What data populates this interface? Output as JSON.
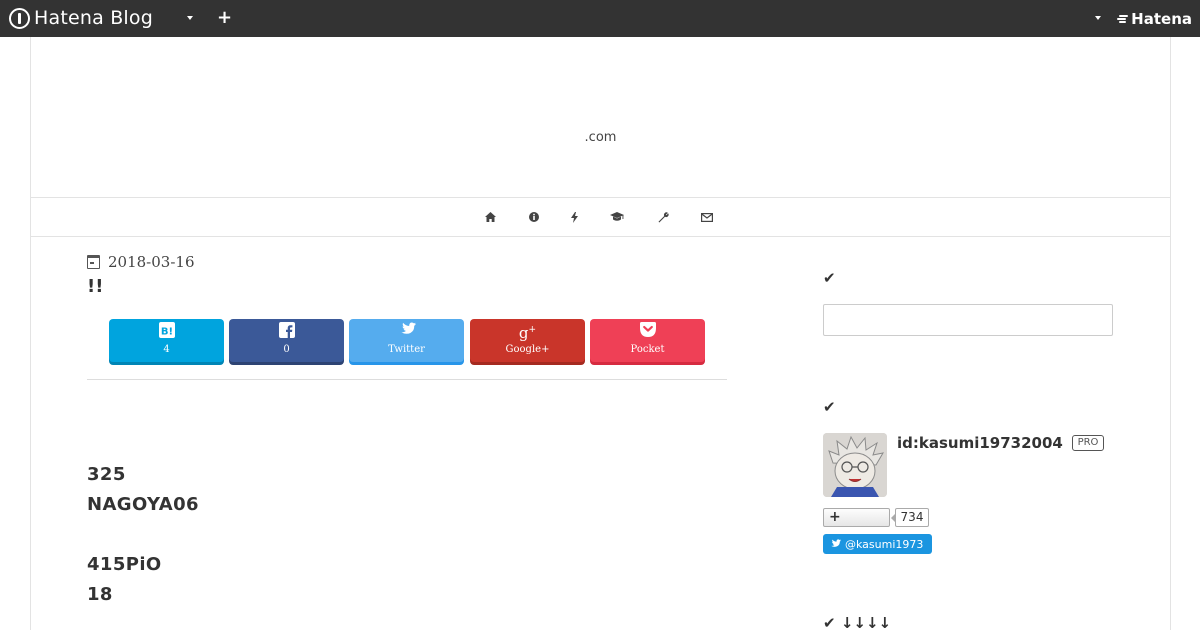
{
  "topbar": {
    "logo_text": "Hatena Blog",
    "right_brand": "Hatena"
  },
  "blog": {
    "title": ".com"
  },
  "nav": {
    "icons": [
      "home-icon",
      "info-icon",
      "bolt-icon",
      "graduation-cap-icon",
      "wrench-icon",
      "envelope-icon"
    ]
  },
  "entry": {
    "date": "2018-03-16",
    "title": "!!",
    "share": [
      {
        "label": "4",
        "icon": "B!",
        "color": "#00a4de"
      },
      {
        "label": "0",
        "icon": "f",
        "color": "#3b5998"
      },
      {
        "label": "Twitter",
        "icon": "twitter-bird",
        "color": "#55acee"
      },
      {
        "label": "Google+",
        "icon": "g+",
        "color": "#dc4e41"
      },
      {
        "label": "Pocket",
        "icon": "pocket",
        "color": "#ef4056"
      }
    ],
    "body_lines": [
      "325",
      "NAGOYA06",
      "415PiO",
      "18"
    ]
  },
  "sidebar": {
    "profile_id": "id:kasumi19732004",
    "pro_badge": "PRO",
    "follower_count": "734",
    "twitter_handle": "@kasumi1973",
    "section3_heading": "↓↓↓↓"
  }
}
